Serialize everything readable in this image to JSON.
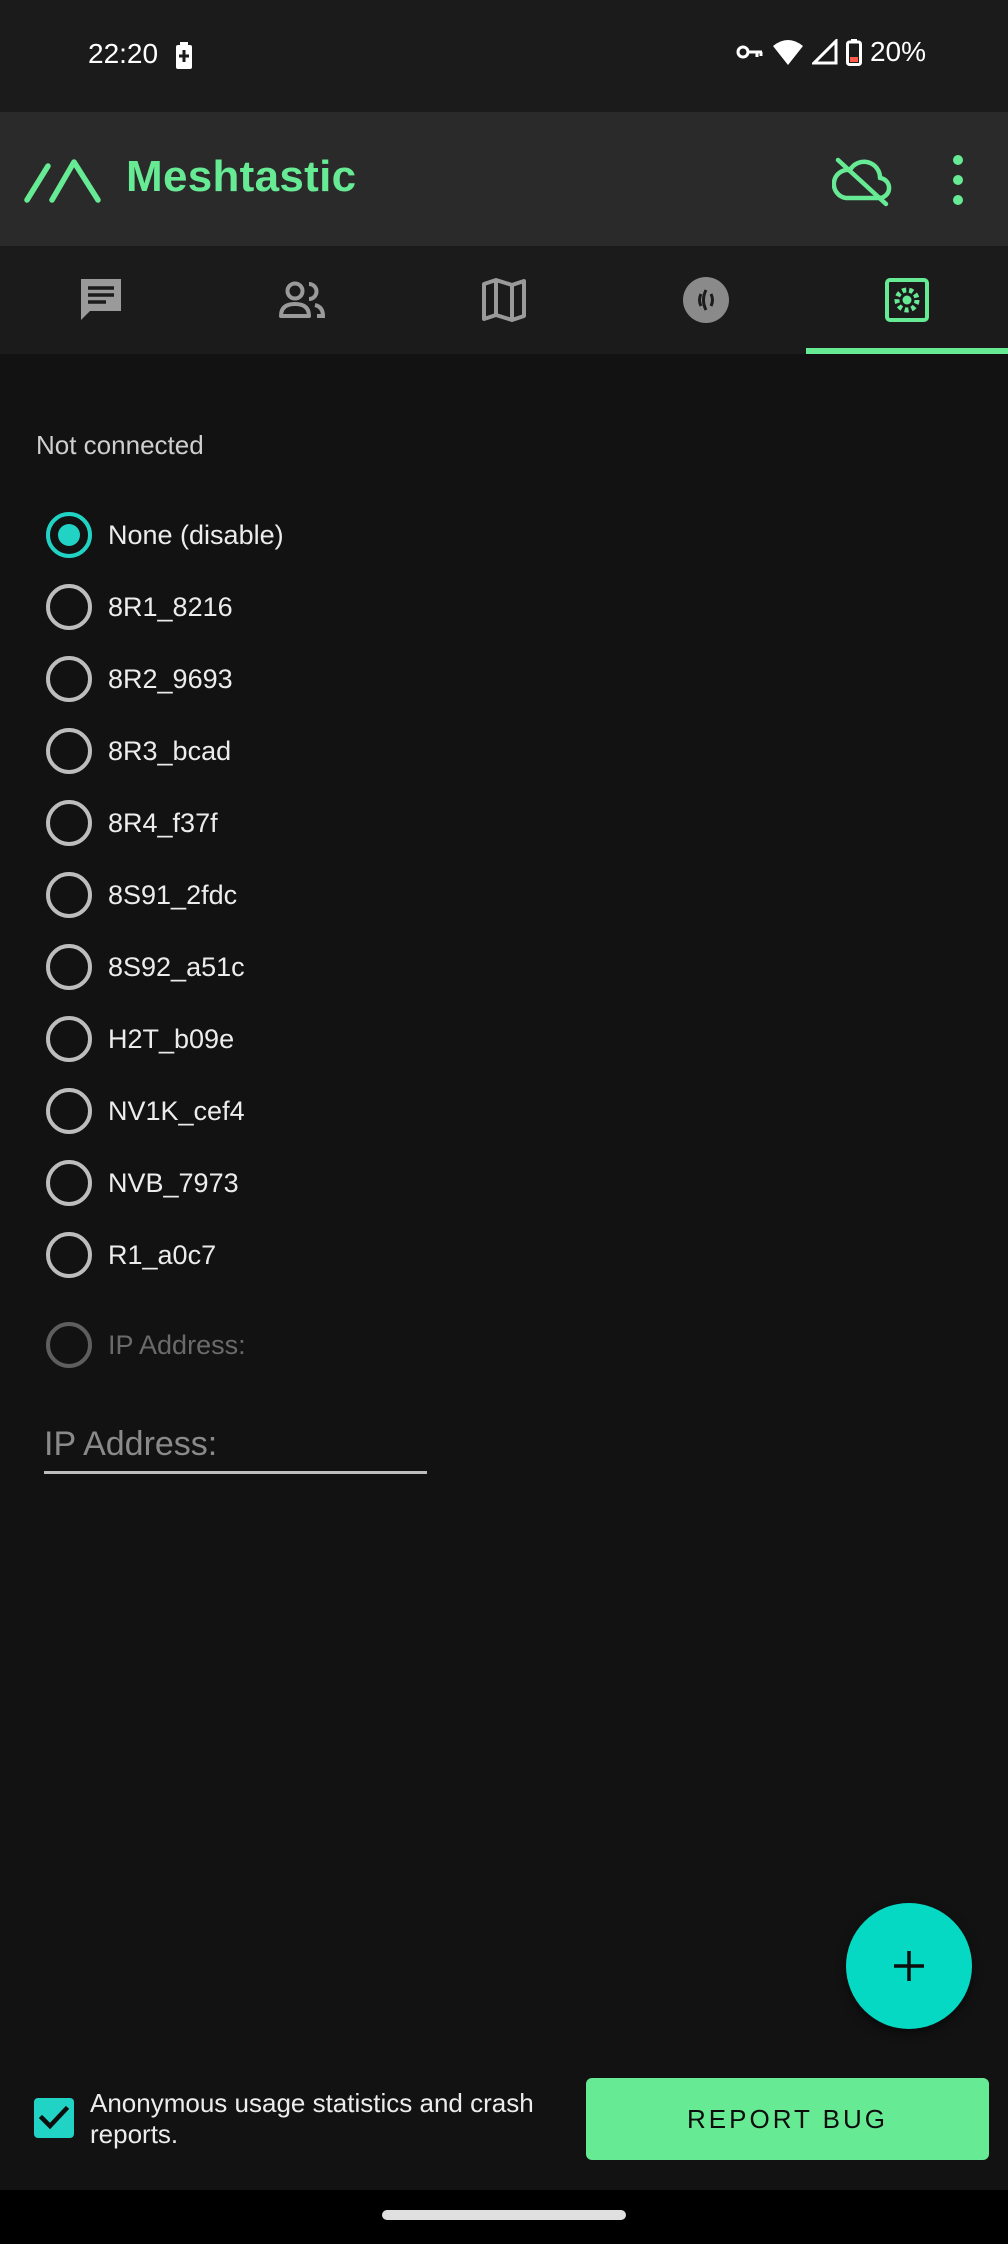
{
  "status_bar": {
    "time": "22:20",
    "battery_percent": "20%",
    "icons": [
      "battery-charging-icon",
      "vpn-key-icon",
      "wifi-icon",
      "cellular-signal-icon",
      "battery-icon"
    ]
  },
  "app_bar": {
    "title": "Meshtastic",
    "logo_icon": "meshtastic-logo-icon",
    "cloud_icon": "cloud-off-icon",
    "menu_icon": "more-vert-icon"
  },
  "tabs": [
    {
      "name": "messages",
      "icon": "chat-icon",
      "selected": false
    },
    {
      "name": "users",
      "icon": "people-icon",
      "selected": false
    },
    {
      "name": "map",
      "icon": "map-icon",
      "selected": false
    },
    {
      "name": "channel",
      "icon": "radio-signal-icon",
      "selected": false
    },
    {
      "name": "settings",
      "icon": "settings-icon",
      "selected": true
    }
  ],
  "connection": {
    "status_text": "Not connected",
    "devices": [
      {
        "label": "None (disable)",
        "selected": true
      },
      {
        "label": "8R1_8216",
        "selected": false
      },
      {
        "label": "8R2_9693",
        "selected": false
      },
      {
        "label": "8R3_bcad",
        "selected": false
      },
      {
        "label": "8R4_f37f",
        "selected": false
      },
      {
        "label": "8S91_2fdc",
        "selected": false
      },
      {
        "label": "8S92_a51c",
        "selected": false
      },
      {
        "label": "H2T_b09e",
        "selected": false
      },
      {
        "label": "NV1K_cef4",
        "selected": false
      },
      {
        "label": "NVB_7973",
        "selected": false
      },
      {
        "label": "R1_a0c7",
        "selected": false
      }
    ],
    "ip_option_label": "IP Address:",
    "ip_input_placeholder": "IP Address:",
    "ip_input_value": ""
  },
  "fab": {
    "icon": "add-icon"
  },
  "footer": {
    "analytics_checked": true,
    "analytics_label": "Anonymous usage statistics and crash reports.",
    "report_bug_label": "REPORT BUG"
  },
  "colors": {
    "accent_green": "#67ea94",
    "accent_teal": "#21d3c4",
    "fab_teal": "#05d8c3",
    "background": "#121212",
    "app_bar": "#2a2a2a"
  }
}
